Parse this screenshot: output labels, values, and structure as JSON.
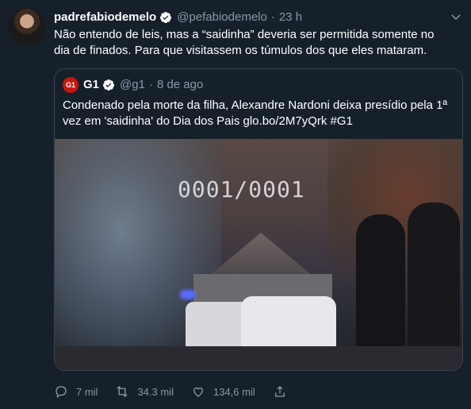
{
  "tweet": {
    "display_name": "padrefabiodemelo",
    "handle": "@pefabiodemelo",
    "separator": "·",
    "time": "23 h",
    "text": "Não entendo de leis, mas a “saidinha” deveria ser permitida somente no dia de finados. Para que visitassem os túmulos dos que eles mataram."
  },
  "quoted": {
    "logo_text": "G1",
    "display_name": "G1",
    "handle": "@g1",
    "separator": "·",
    "date": "8 de ago",
    "text": "Condenado pela morte da filha, Alexandre Nardoni deixa presídio pela 1ª vez em 'saidinha' do Dia dos Pais glo.bo/2M7yQrk #G1",
    "media_stamp": "0001/0001"
  },
  "actions": {
    "replies": "7 mil",
    "retweets": "34.3 mil",
    "likes": "134,6 mil"
  },
  "colors": {
    "background": "#15202b",
    "muted": "#8899a6",
    "verified": "#ffffff",
    "g1_red": "#c4170c",
    "border": "#38444d"
  },
  "icons": [
    "verified-icon",
    "chevron-down-icon",
    "reply-icon",
    "retweet-icon",
    "like-icon",
    "share-icon"
  ]
}
